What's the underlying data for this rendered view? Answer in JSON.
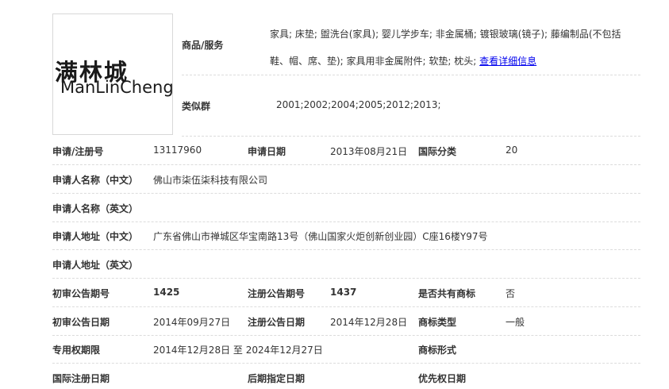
{
  "logo": {
    "cn": "满林城",
    "en": "ManLinCheng"
  },
  "goods": {
    "label": "商品/服务",
    "text_line1": "家具; 床垫; 盥洗台(家具); 婴儿学步车; 非金属桶; 镀银玻璃(镜子); 藤编制品(不包括",
    "text_line2": "鞋、帽、席、垫); 家具用非金属附件; 软垫; 枕头; ",
    "link": "查看详细信息"
  },
  "similar_group": {
    "label": "类似群",
    "value": "2001;2002;2004;2005;2012;2013;"
  },
  "rows": {
    "reg_no_label": "申请/注册号",
    "reg_no": "13117960",
    "apply_date_label": "申请日期",
    "apply_date": "2013年08月21日",
    "intl_class_label": "国际分类",
    "intl_class": "20",
    "applicant_cn_label": "申请人名称（中文）",
    "applicant_cn": "佛山市柒伍柒科技有限公司",
    "applicant_en_label": "申请人名称（英文）",
    "applicant_en": "",
    "address_cn_label": "申请人地址（中文）",
    "address_cn": "广东省佛山市禅城区华宝南路13号（佛山国家火炬创新创业园）C座16楼Y97号",
    "address_en_label": "申请人地址（英文）",
    "address_en": "",
    "prelim_no_label": "初审公告期号",
    "prelim_no": "1425",
    "reg_pub_no_label": "注册公告期号",
    "reg_pub_no": "1437",
    "shared_label": "是否共有商标",
    "shared": "否",
    "prelim_date_label": "初审公告日期",
    "prelim_date": "2014年09月27日",
    "reg_pub_date_label": "注册公告日期",
    "reg_pub_date": "2014年12月28日",
    "tm_type_label": "商标类型",
    "tm_type": "一般",
    "exclusive_label": "专用权期限",
    "exclusive": "2014年12月28日 至 2024年12月27日",
    "tm_form_label": "商标形式",
    "tm_form": "",
    "intl_reg_date_label": "国际注册日期",
    "intl_reg_date": "",
    "later_date_label": "后期指定日期",
    "later_date": "",
    "priority_date_label": "优先权日期",
    "priority_date": ""
  }
}
